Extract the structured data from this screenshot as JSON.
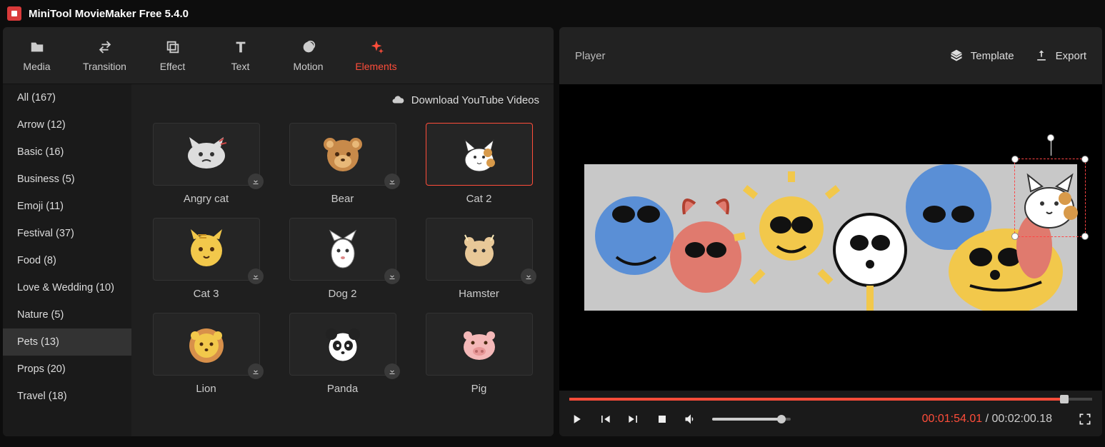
{
  "app": {
    "title": "MiniTool MovieMaker Free 5.4.0"
  },
  "toolbar": {
    "items": [
      {
        "label": "Media",
        "icon": "folder-icon"
      },
      {
        "label": "Transition",
        "icon": "arrows-icon"
      },
      {
        "label": "Effect",
        "icon": "layers-icon"
      },
      {
        "label": "Text",
        "icon": "text-icon"
      },
      {
        "label": "Motion",
        "icon": "circle-icon"
      },
      {
        "label": "Elements",
        "icon": "sparkle-icon"
      }
    ],
    "active": "Elements"
  },
  "categories": [
    {
      "label": "All (167)"
    },
    {
      "label": "Arrow (12)"
    },
    {
      "label": "Basic (16)"
    },
    {
      "label": "Business (5)"
    },
    {
      "label": "Emoji (11)"
    },
    {
      "label": "Festival (37)"
    },
    {
      "label": "Food (8)"
    },
    {
      "label": "Love & Wedding (10)"
    },
    {
      "label": "Nature (5)"
    },
    {
      "label": "Pets (13)"
    },
    {
      "label": "Props (20)"
    },
    {
      "label": "Travel (18)"
    }
  ],
  "active_category": "Pets (13)",
  "banner": {
    "label": "Download YouTube Videos"
  },
  "elements": [
    {
      "label": "Angry cat",
      "downloadable": true,
      "selected": false,
      "sprite": "angrycat"
    },
    {
      "label": "Bear",
      "downloadable": true,
      "selected": false,
      "sprite": "bear"
    },
    {
      "label": "Cat 2",
      "downloadable": false,
      "selected": true,
      "sprite": "cat2"
    },
    {
      "label": "Cat 3",
      "downloadable": true,
      "selected": false,
      "sprite": "cat3"
    },
    {
      "label": "Dog 2",
      "downloadable": true,
      "selected": false,
      "sprite": "dog2"
    },
    {
      "label": "Hamster",
      "downloadable": true,
      "selected": false,
      "sprite": "hamster"
    },
    {
      "label": "Lion",
      "downloadable": true,
      "selected": false,
      "sprite": "lion"
    },
    {
      "label": "Panda",
      "downloadable": true,
      "selected": false,
      "sprite": "panda"
    },
    {
      "label": "Pig",
      "downloadable": false,
      "selected": false,
      "sprite": "pig"
    }
  ],
  "player": {
    "title": "Player",
    "template_label": "Template",
    "export_label": "Export",
    "current_time": "00:01:54.01",
    "total_time": "00:02:00.18",
    "progress_pct": 94
  }
}
